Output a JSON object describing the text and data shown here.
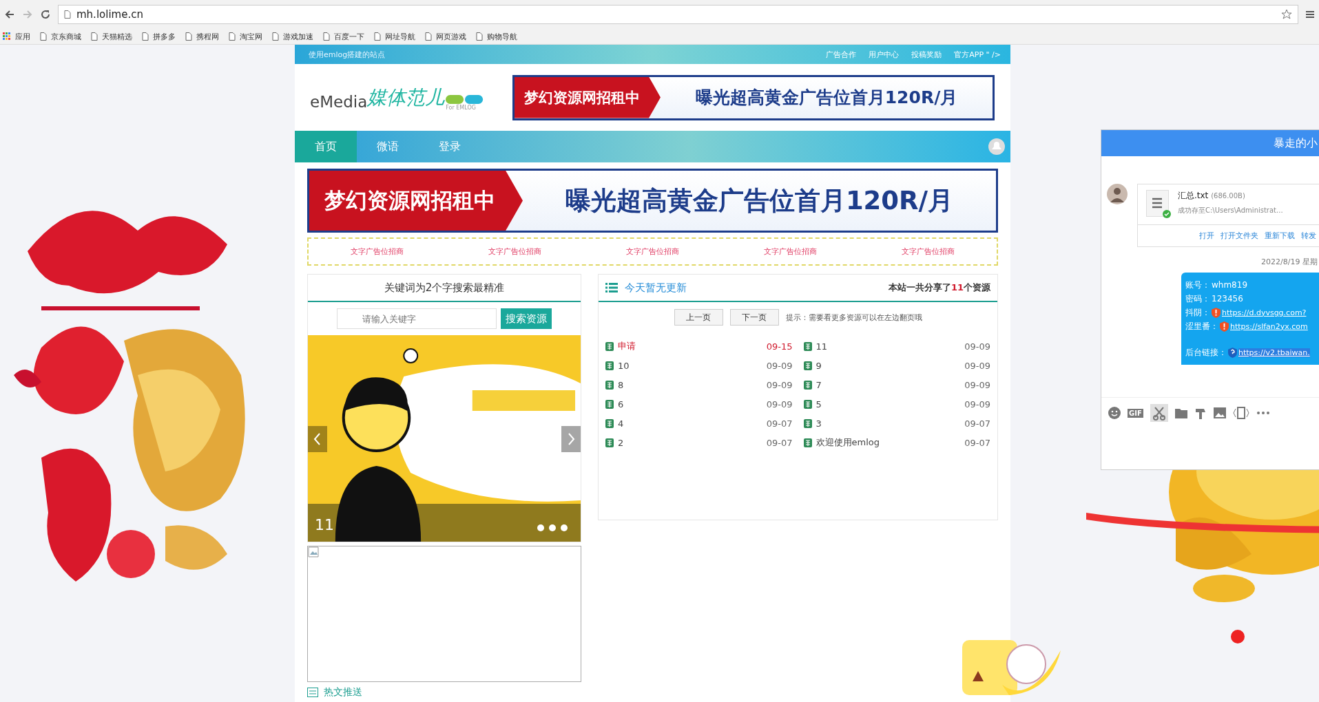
{
  "browser": {
    "url": "mh.lolime.cn",
    "bookmarks": [
      "应用",
      "京东商城",
      "天猫精选",
      "拼多多",
      "携程网",
      "淘宝网",
      "游戏加速",
      "百度一下",
      "网址导航",
      "网页游戏",
      "购物导航"
    ]
  },
  "topbar": {
    "tagline": "使用emlog搭建的站点",
    "links": [
      "广告合作",
      "用户中心",
      "投稿奖励",
      "官方APP \" />"
    ]
  },
  "logo": {
    "brand": "eMedia",
    "name": "媒体范儿",
    "sub": "For EMLOG"
  },
  "header_banner": {
    "left": "梦幻资源网招租中",
    "right": "曝光超高黄金广告位首月120R/月"
  },
  "nav": [
    {
      "label": "首页",
      "selected": true
    },
    {
      "label": "微语",
      "selected": false
    },
    {
      "label": "登录",
      "selected": false
    }
  ],
  "main_banner": {
    "left": "梦幻资源网招租中",
    "right": "曝光超高黄金广告位首月120R/月"
  },
  "text_ads": [
    "文字广告位招商",
    "文字广告位招商",
    "文字广告位招商",
    "文字广告位招商",
    "文字广告位招商"
  ],
  "search_panel": {
    "title": "关键词为2个字搜索最精准",
    "placeholder": "请输入关键字",
    "button": "搜索资源"
  },
  "slider": {
    "caption": "11"
  },
  "updates": {
    "title": "今天暂无更新",
    "summary_before": "本站一共分享了",
    "count": "11",
    "summary_after": "个资源",
    "pager": [
      "上一页",
      "下一页"
    ],
    "hint": "提示：需要看更多资源可以在左边翻页哦",
    "articles": [
      {
        "title": "申请",
        "date": "09-15",
        "highlighted": true
      },
      {
        "title": "11",
        "date": "09-09",
        "highlighted": false
      },
      {
        "title": "10",
        "date": "09-09",
        "highlighted": false
      },
      {
        "title": "9",
        "date": "09-09",
        "highlighted": false
      },
      {
        "title": "8",
        "date": "09-09",
        "highlighted": false
      },
      {
        "title": "7",
        "date": "09-09",
        "highlighted": false
      },
      {
        "title": "6",
        "date": "09-09",
        "highlighted": false
      },
      {
        "title": "5",
        "date": "09-09",
        "highlighted": false
      },
      {
        "title": "4",
        "date": "09-07",
        "highlighted": false
      },
      {
        "title": "3",
        "date": "09-07",
        "highlighted": false
      },
      {
        "title": "2",
        "date": "09-07",
        "highlighted": false
      },
      {
        "title": "欢迎使用emlog",
        "date": "09-07",
        "highlighted": false
      }
    ]
  },
  "bottom_section": {
    "title": "热文推送"
  },
  "chat": {
    "title": "暴走的小",
    "file": {
      "name": "汇总.txt",
      "size": "(686.00B)",
      "status": "成功存至C:\\Users\\Administrat...",
      "actions": [
        "打开",
        "打开文件夹",
        "重新下载",
        "转发"
      ]
    },
    "time": "2022/8/19 星期",
    "lines": [
      {
        "label": "账号：",
        "value": "whm819",
        "kind": "plain"
      },
      {
        "label": "密码：",
        "value": "123456",
        "kind": "plain"
      },
      {
        "label": "抖阴：",
        "value": "https://d.dyvsgg.com?",
        "kind": "warning-link"
      },
      {
        "label": "涩里番：",
        "value": "https://slfan2yx.com",
        "kind": "warning-link"
      },
      {
        "label": "后台链接：",
        "value": "https://v2.tbaiwan.",
        "kind": "unknown-link"
      }
    ],
    "gif": "GIF"
  }
}
